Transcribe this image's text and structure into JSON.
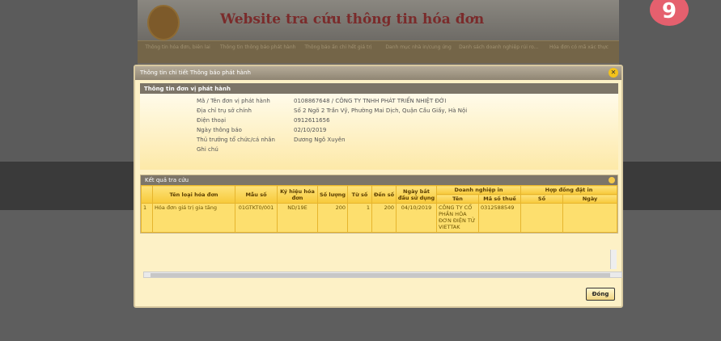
{
  "site": {
    "title": "Website tra cứu thông tin hóa đơn",
    "nav": [
      "Thông tin hóa đơn, biên lai",
      "Thông tin thông báo phát hành",
      "Thông báo ấn chỉ hết giá trị",
      "Danh mục nhà in/cung ứng",
      "Danh sách doanh nghiệp rủi ro...",
      "Hóa đơn có mã xác thực"
    ],
    "brand": "9"
  },
  "dialog": {
    "title": "Thông tin chi tiết Thông báo phát hành",
    "close": "✕",
    "ok": "Đóng",
    "issuer": {
      "heading": "Thông tin đơn vị phát hành",
      "rows": [
        {
          "k": "Mã / Tên đơn vị phát hành",
          "v": "0108867648 / CÔNG TY TNHH PHÁT TRIỂN NHIỆT ĐỚI"
        },
        {
          "k": "Địa chỉ trụ sở chính",
          "v": "Số 2 Ngõ 2 Trần Vỹ, Phường Mai Dịch, Quận Cầu Giấy, Hà Nội"
        },
        {
          "k": "Điện thoại",
          "v": "0912611656"
        },
        {
          "k": "Ngày thông báo",
          "v": "02/10/2019"
        },
        {
          "k": "Thủ trưởng tổ chức/cá nhân",
          "v": "Dương Ngô Xuyên"
        },
        {
          "k": "Ghi chú",
          "v": ""
        }
      ]
    },
    "result": {
      "heading": "Kết quả tra cứu",
      "headers": {
        "name": "Tên loại hóa đơn",
        "form": "Mẫu số",
        "symbol": "Ký hiệu hóa đơn",
        "qty": "Số lượng",
        "from": "Từ số",
        "to": "Đến số",
        "start": "Ngày bắt đầu sử dụng",
        "printer": "Doanh nghiệp in",
        "pname": "Tên",
        "ptax": "Mã số thuế",
        "contract": "Hợp đồng đặt in",
        "cno": "Số",
        "cdate": "Ngày"
      },
      "rows": [
        {
          "idx": "1",
          "name": "Hóa đơn giá trị gia tăng",
          "form": "01GTKT0/001",
          "symbol": "ND/19E",
          "qty": "200",
          "from": "1",
          "to": "200",
          "start": "04/10/2019",
          "pname": "CÔNG TY CỔ PHẦN HÓA ĐƠN ĐIỆN TỬ VIETTAK",
          "ptax": "0312588549",
          "cno": "",
          "cdate": ""
        }
      ]
    }
  }
}
